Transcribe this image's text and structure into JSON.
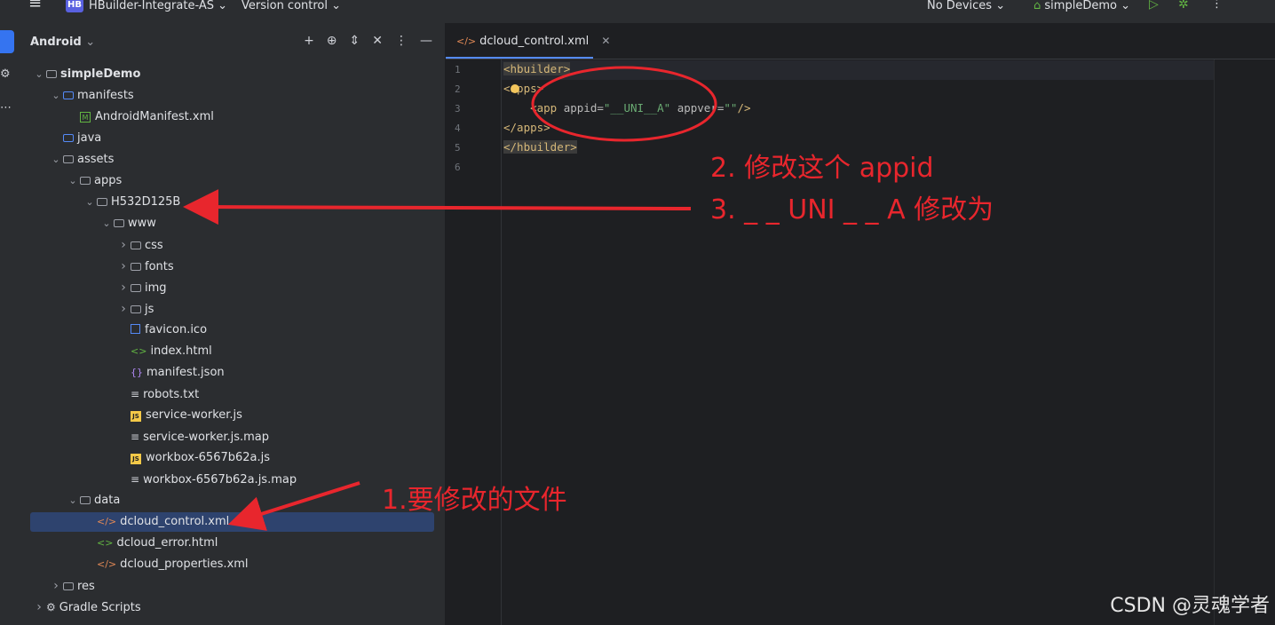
{
  "topbar": {
    "menu_icon": "hamburger-icon",
    "project_badge": "HB",
    "project_name": "HBuilder-Integrate-AS",
    "vcs": "Version control",
    "devices": "No Devices",
    "run_config": "simpleDemo"
  },
  "panel": {
    "title": "Android"
  },
  "tree": [
    {
      "label": "simpleDemo",
      "depth": 0,
      "chevron": "down",
      "icon": "module",
      "bold": true
    },
    {
      "label": "manifests",
      "depth": 1,
      "chevron": "down",
      "icon": "folder-src"
    },
    {
      "label": "AndroidManifest.xml",
      "depth": 2,
      "chevron": "",
      "icon": "manifest"
    },
    {
      "label": "java",
      "depth": 1,
      "chevron": "",
      "icon": "folder-src"
    },
    {
      "label": "assets",
      "depth": 1,
      "chevron": "down",
      "icon": "folder"
    },
    {
      "label": "apps",
      "depth": 2,
      "chevron": "down",
      "icon": "folder"
    },
    {
      "label": "H532D125B",
      "depth": 3,
      "chevron": "down",
      "icon": "folder"
    },
    {
      "label": "www",
      "depth": 4,
      "chevron": "down",
      "icon": "folder"
    },
    {
      "label": "css",
      "depth": 5,
      "chevron": "right",
      "icon": "folder"
    },
    {
      "label": "fonts",
      "depth": 5,
      "chevron": "right",
      "icon": "folder"
    },
    {
      "label": "img",
      "depth": 5,
      "chevron": "right",
      "icon": "folder"
    },
    {
      "label": "js",
      "depth": 5,
      "chevron": "right",
      "icon": "folder"
    },
    {
      "label": "favicon.ico",
      "depth": 5,
      "chevron": "",
      "icon": "image"
    },
    {
      "label": "index.html",
      "depth": 5,
      "chevron": "",
      "icon": "html"
    },
    {
      "label": "manifest.json",
      "depth": 5,
      "chevron": "",
      "icon": "json"
    },
    {
      "label": "robots.txt",
      "depth": 5,
      "chevron": "",
      "icon": "text"
    },
    {
      "label": "service-worker.js",
      "depth": 5,
      "chevron": "",
      "icon": "js"
    },
    {
      "label": "service-worker.js.map",
      "depth": 5,
      "chevron": "",
      "icon": "text"
    },
    {
      "label": "workbox-6567b62a.js",
      "depth": 5,
      "chevron": "",
      "icon": "js"
    },
    {
      "label": "workbox-6567b62a.js.map",
      "depth": 5,
      "chevron": "",
      "icon": "text"
    },
    {
      "label": "data",
      "depth": 2,
      "chevron": "down",
      "icon": "folder"
    },
    {
      "label": "dcloud_control.xml",
      "depth": 3,
      "chevron": "",
      "icon": "xml",
      "selected": true
    },
    {
      "label": "dcloud_error.html",
      "depth": 3,
      "chevron": "",
      "icon": "html"
    },
    {
      "label": "dcloud_properties.xml",
      "depth": 3,
      "chevron": "",
      "icon": "xml"
    },
    {
      "label": "res",
      "depth": 1,
      "chevron": "right",
      "icon": "folder"
    },
    {
      "label": "Gradle Scripts",
      "depth": 0,
      "chevron": "right",
      "icon": "gradle"
    }
  ],
  "editor": {
    "tab_label": "dcloud_control.xml",
    "line_numbers": [
      "1",
      "2",
      "3",
      "4",
      "5",
      "6"
    ],
    "lines": [
      [
        {
          "t": "<hbuilder>",
          "c": "tag tagbg"
        }
      ],
      [
        {
          "t": "<",
          "c": "tag"
        },
        {
          "t": "apps",
          "c": "tag"
        },
        {
          "t": ">",
          "c": "tag"
        }
      ],
      [
        {
          "t": "    <app ",
          "c": "tag"
        },
        {
          "t": "appid",
          "c": "attr"
        },
        {
          "t": "=",
          "c": "attr"
        },
        {
          "t": "\"__UNI__A\"",
          "c": "val"
        },
        {
          "t": " appver",
          "c": "attr"
        },
        {
          "t": "=",
          "c": "attr"
        },
        {
          "t": "\"\"",
          "c": "val"
        },
        {
          "t": "/>",
          "c": "tag"
        }
      ],
      [
        {
          "t": "</apps>",
          "c": "tag"
        }
      ],
      [
        {
          "t": "</hbuilder>",
          "c": "tag tagbg"
        }
      ],
      []
    ]
  },
  "annotations": {
    "note1": "1.要修改的文件",
    "note2": "2. 修改这个 appid",
    "note3": "3. _ _ UNI _ _ A 修改为"
  },
  "watermark": "CSDN @灵魂学者",
  "colors": {
    "annotation": "#e8262d",
    "selection": "#2e436e",
    "accent": "#548af7"
  }
}
